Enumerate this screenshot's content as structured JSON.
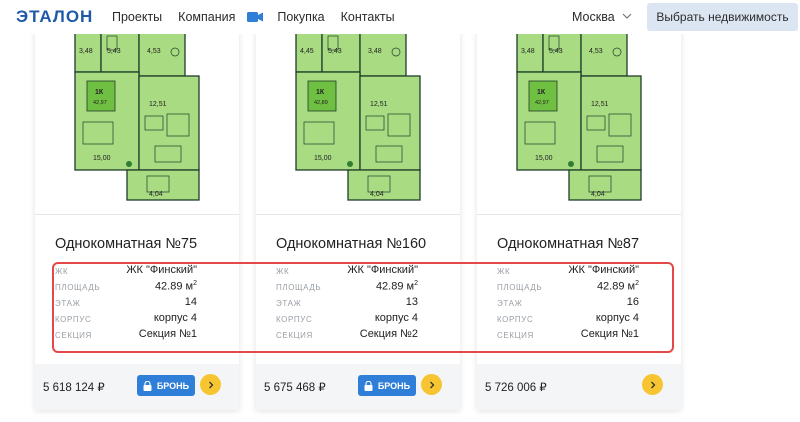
{
  "header": {
    "logo": "ЭТАЛОН",
    "nav": [
      "Проекты",
      "Компания",
      "Покупка",
      "Контакты"
    ],
    "city": "Москва",
    "select_button": "Выбрать недвижимость"
  },
  "colors": {
    "brand": "#1e5aa8",
    "plan_green": "#a9dc82",
    "booking_blue": "#2f7fd8",
    "arrow_yellow": "#f6c531",
    "highlight_red": "#e54848"
  },
  "labels": {
    "complex": "ЖК",
    "area": "ПЛОЩАДЬ",
    "floor": "ЭТАЖ",
    "building": "КОРПУС",
    "section": "СЕКЦИЯ",
    "area_unit": "м",
    "book": "БРОНЬ"
  },
  "cards": [
    {
      "plan_texts": {
        "a": "3,48",
        "b": "5,43",
        "c": "4,53",
        "badge_type": "1К",
        "badge_area": "42,97",
        "living": "12,51",
        "main": "15,00",
        "balcony": "4,04"
      },
      "title": "Однокомнатная №75",
      "complex": "ЖК \"Финский\"",
      "area": "42.89",
      "floor": "14",
      "building": "корпус 4",
      "section": "Секция №1",
      "price": "5 618 124 ₽",
      "bookable": true
    },
    {
      "plan_texts": {
        "a": "4,45",
        "b": "5,43",
        "c": "3,48",
        "badge_type": "1К",
        "badge_area": "42,89",
        "living": "12,51",
        "main": "15,00",
        "balcony": "4,04"
      },
      "title": "Однокомнатная №160",
      "complex": "ЖК \"Финский\"",
      "area": "42.89",
      "floor": "13",
      "building": "корпус 4",
      "section": "Секция №2",
      "price": "5 675 468 ₽",
      "bookable": true
    },
    {
      "plan_texts": {
        "a": "3,48",
        "b": "5,43",
        "c": "4,53",
        "badge_type": "1К",
        "badge_area": "42,97",
        "living": "12,51",
        "main": "15,00",
        "balcony": "4,04"
      },
      "title": "Однокомнатная №87",
      "complex": "ЖК \"Финский\"",
      "area": "42.89",
      "floor": "16",
      "building": "корпус 4",
      "section": "Секция №1",
      "price": "5 726 006 ₽",
      "bookable": false
    }
  ]
}
